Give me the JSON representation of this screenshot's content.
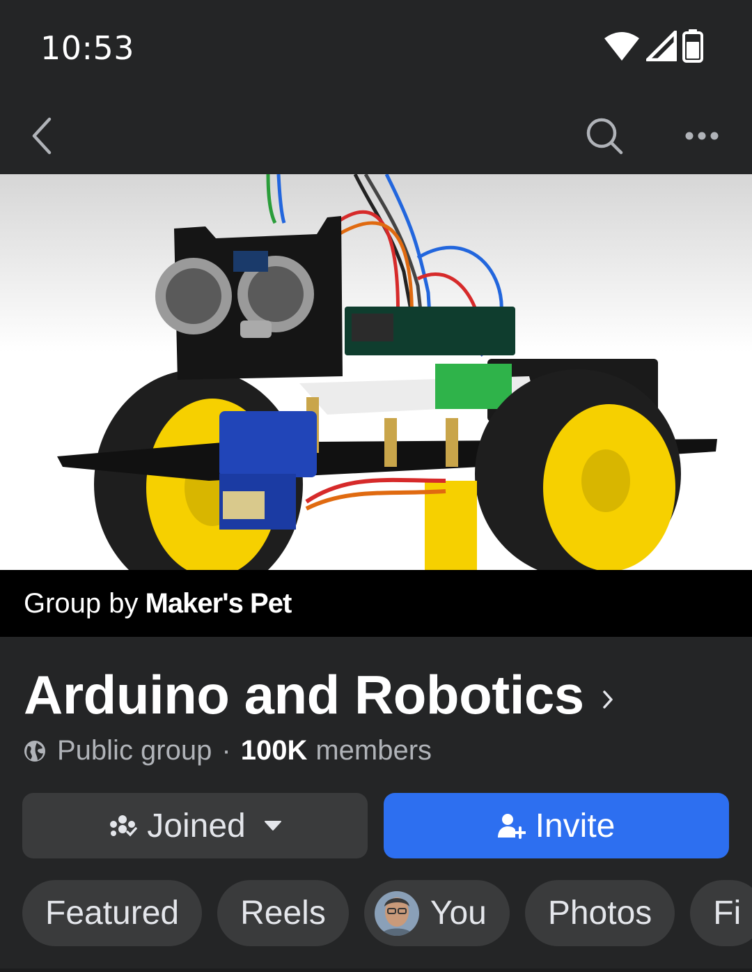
{
  "status_bar": {
    "time": "10:53",
    "icons": [
      "wifi-icon",
      "signal-icon",
      "battery-icon"
    ]
  },
  "nav": {
    "back_icon": "chevron-left-icon",
    "search_icon": "search-icon",
    "more_icon": "more-dots-icon"
  },
  "cover": {
    "alt": "robot-car-photo"
  },
  "group_by": {
    "prefix": "Group by",
    "owner": "Maker's Pet"
  },
  "group": {
    "title": "Arduino and Robotics",
    "privacy": "Public group",
    "separator": "·",
    "member_count": "100K",
    "member_label": "members"
  },
  "actions": {
    "joined_label": "Joined",
    "invite_label": "Invite"
  },
  "tabs": [
    {
      "label": "Featured"
    },
    {
      "label": "Reels"
    },
    {
      "label": "You"
    },
    {
      "label": "Photos"
    },
    {
      "label": "Fi"
    }
  ],
  "colors": {
    "background": "#242526",
    "accent": "#2d6ff0",
    "chip": "#3a3b3c",
    "robot_wheel": "#f6d000"
  }
}
